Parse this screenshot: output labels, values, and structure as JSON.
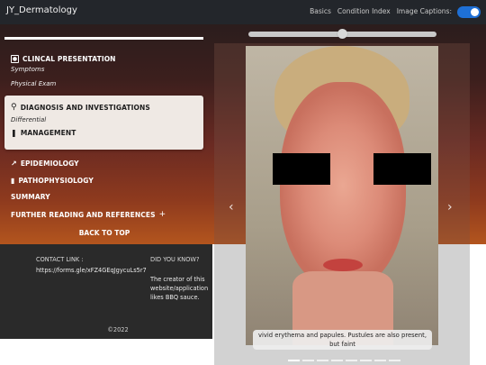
{
  "header": {
    "brand": "JY_Dermatology",
    "nav": [
      "Basics",
      "Condition Index",
      "Image Captions:"
    ],
    "captions_toggle_on": true
  },
  "sidebar": {
    "clinical": {
      "title": "CLINCAL PRESENTATION",
      "icon": "person-icon",
      "items": [
        "Symptoms",
        "Physical Exam"
      ]
    },
    "diagnosis": {
      "title": "DIAGNOSIS AND INVESTIGATIONS",
      "icon": "search-icon",
      "items": [
        "Differential"
      ]
    },
    "management": {
      "title": "MANAGEMENT",
      "icon": "pill-icon"
    },
    "epidemiology": {
      "title": "EPIDEMIOLOGY",
      "icon": "chart-icon"
    },
    "pathophysiology": {
      "title": "PATHOPHYSIOLOGY",
      "icon": "clipboard-icon"
    },
    "summary": {
      "title": "SUMMARY"
    },
    "further": {
      "title": "FURTHER READING AND REFERENCES",
      "plus": "+"
    },
    "back_to_top": "BACK TO TOP"
  },
  "footer": {
    "contact_label": "CONTACT LINK :",
    "contact_link": "https://forms.gle/xFZ4GEqJgycuLs5r7",
    "didyou_title": "DID YOU KNOW?",
    "didyou_body": "The creator of this website/application likes BBQ sauce.",
    "copyright": "©2022"
  },
  "carousel": {
    "caption": "vivid erythema and papules. Pustules are also present, but faint",
    "prev_glyph": "‹",
    "next_glyph": "›",
    "slide_count": 8,
    "active_slide": 1
  }
}
